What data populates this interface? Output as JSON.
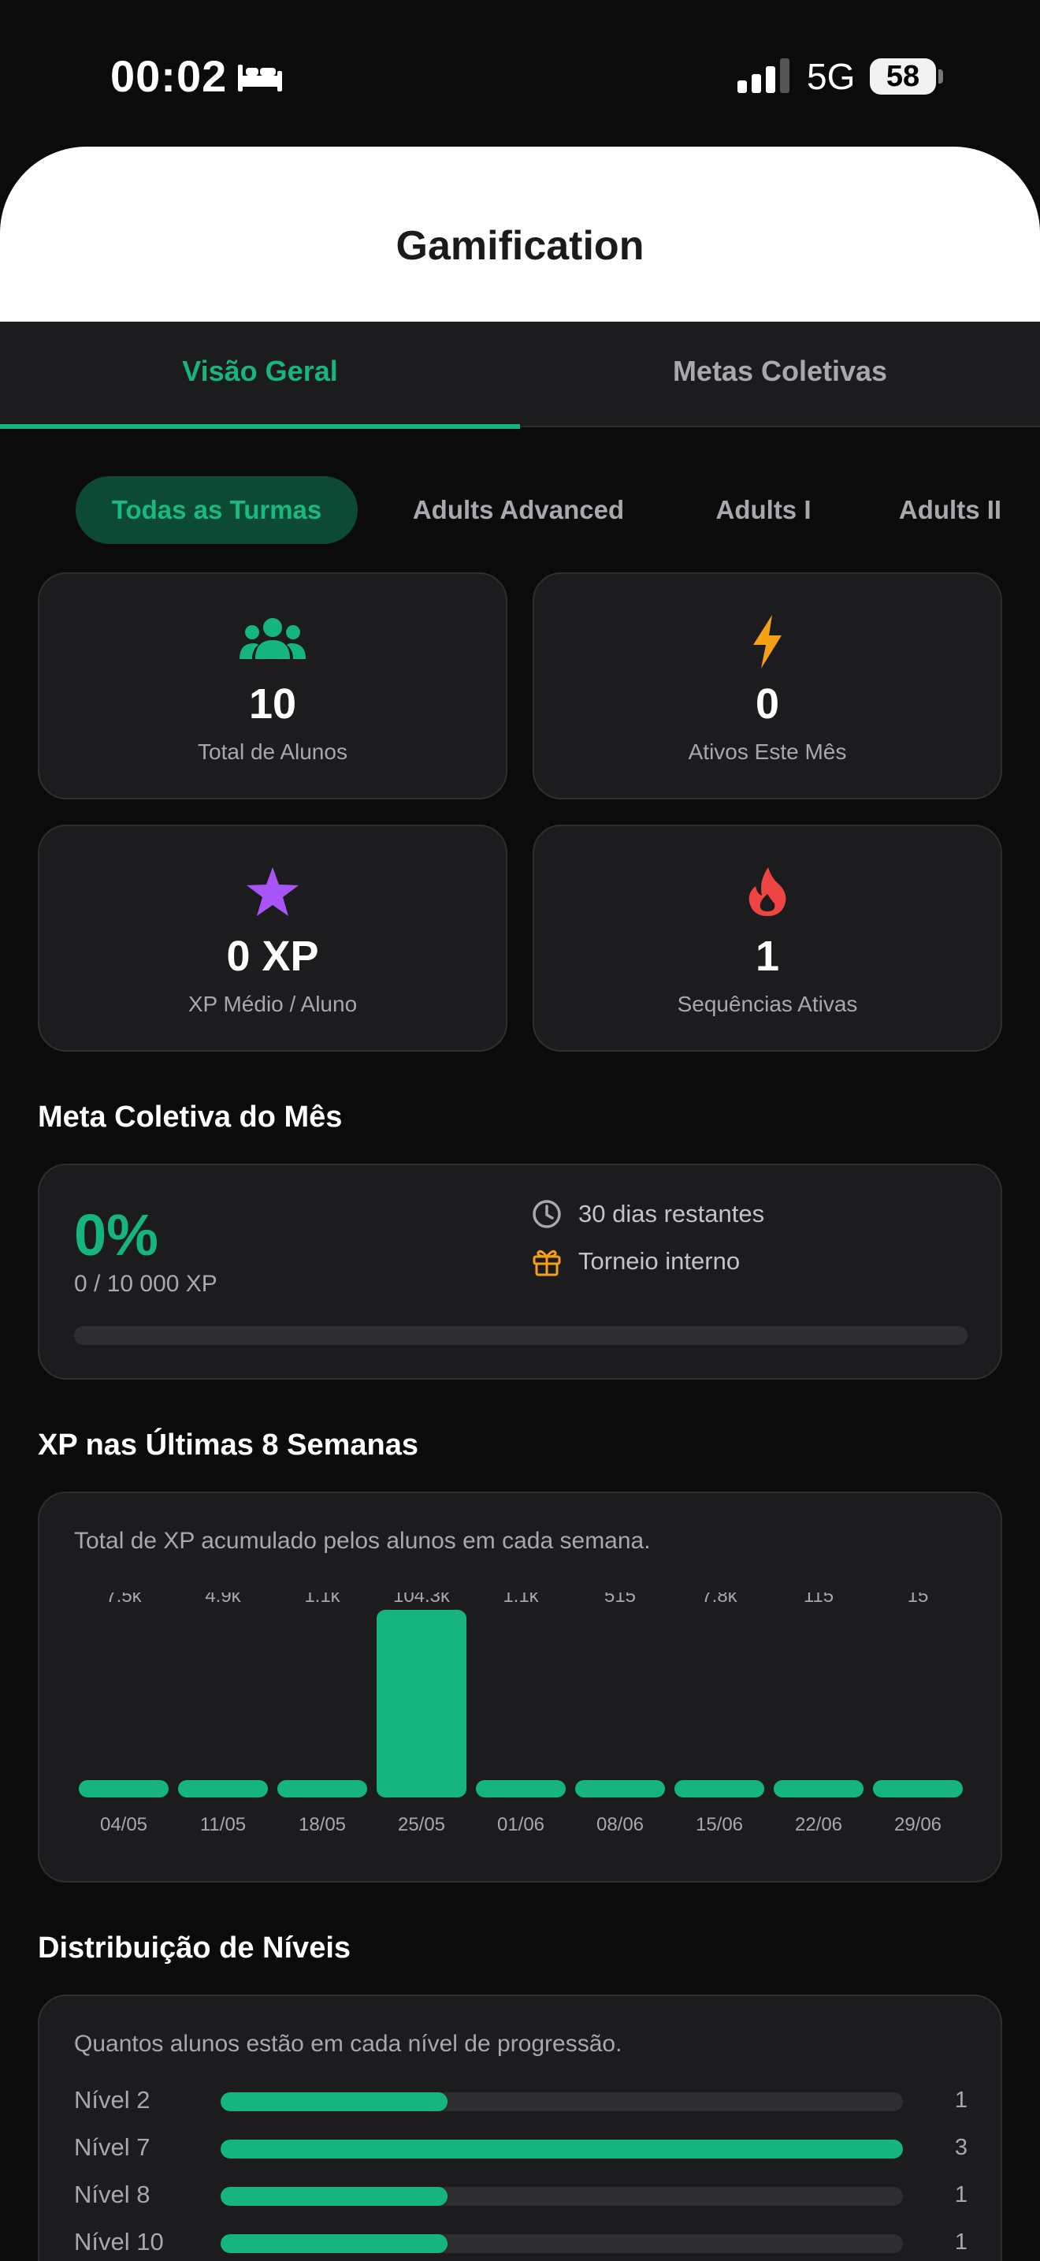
{
  "status_bar": {
    "time": "00:02",
    "network": "5G",
    "battery": "58"
  },
  "header": {
    "title": "Gamification"
  },
  "tabs": [
    {
      "label": "Visão Geral",
      "active": true
    },
    {
      "label": "Metas Coletivas",
      "active": false
    }
  ],
  "filters": [
    {
      "label": "Todas as Turmas",
      "active": true
    },
    {
      "label": "Adults Advanced",
      "active": false
    },
    {
      "label": "Adults I",
      "active": false
    },
    {
      "label": "Adults II",
      "active": false
    }
  ],
  "stats": [
    {
      "icon": "users-icon",
      "color": "#16b57f",
      "value": "10",
      "label": "Total de Alunos"
    },
    {
      "icon": "lightning-icon",
      "color": "#f5a015",
      "value": "0",
      "label": "Ativos Este Mês"
    },
    {
      "icon": "star-icon",
      "color": "#a855f7",
      "value": "0 XP",
      "label": "XP Médio / Aluno"
    },
    {
      "icon": "flame-icon",
      "color": "#ef4444",
      "value": "1",
      "label": "Sequências Ativas"
    }
  ],
  "monthly_goal": {
    "section_title": "Meta Coletiva do Mês",
    "percent": "0%",
    "progress_text": "0 / 10 000 XP",
    "progress_fraction": 0,
    "days_remaining": "30 dias restantes",
    "reward": "Torneio interno"
  },
  "weekly_chart": {
    "section_title": "XP nas Últimas 8 Semanas",
    "caption": "Total de XP acumulado pelos alunos em cada semana."
  },
  "chart_data": {
    "type": "bar",
    "categories": [
      "04/05",
      "11/05",
      "18/05",
      "25/05",
      "01/06",
      "08/06",
      "15/06",
      "22/06",
      "29/06"
    ],
    "values": [
      7500,
      4900,
      1100,
      104300,
      1100,
      515,
      7800,
      115,
      15
    ],
    "value_labels": [
      "7.5k",
      "4.9k",
      "1.1k",
      "104.3k",
      "1.1k",
      "515",
      "7.8k",
      "115",
      "15"
    ],
    "color": "#16b57f"
  },
  "levels": {
    "section_title": "Distribuição de Níveis",
    "caption": "Quantos alunos estão em cada nível de progressão.",
    "rows": [
      {
        "label": "Nível 2",
        "count": "1",
        "fraction": 0.333
      },
      {
        "label": "Nível 7",
        "count": "3",
        "fraction": 1.0
      },
      {
        "label": "Nível 8",
        "count": "1",
        "fraction": 0.333
      },
      {
        "label": "Nível 10",
        "count": "1",
        "fraction": 0.333
      }
    ]
  }
}
